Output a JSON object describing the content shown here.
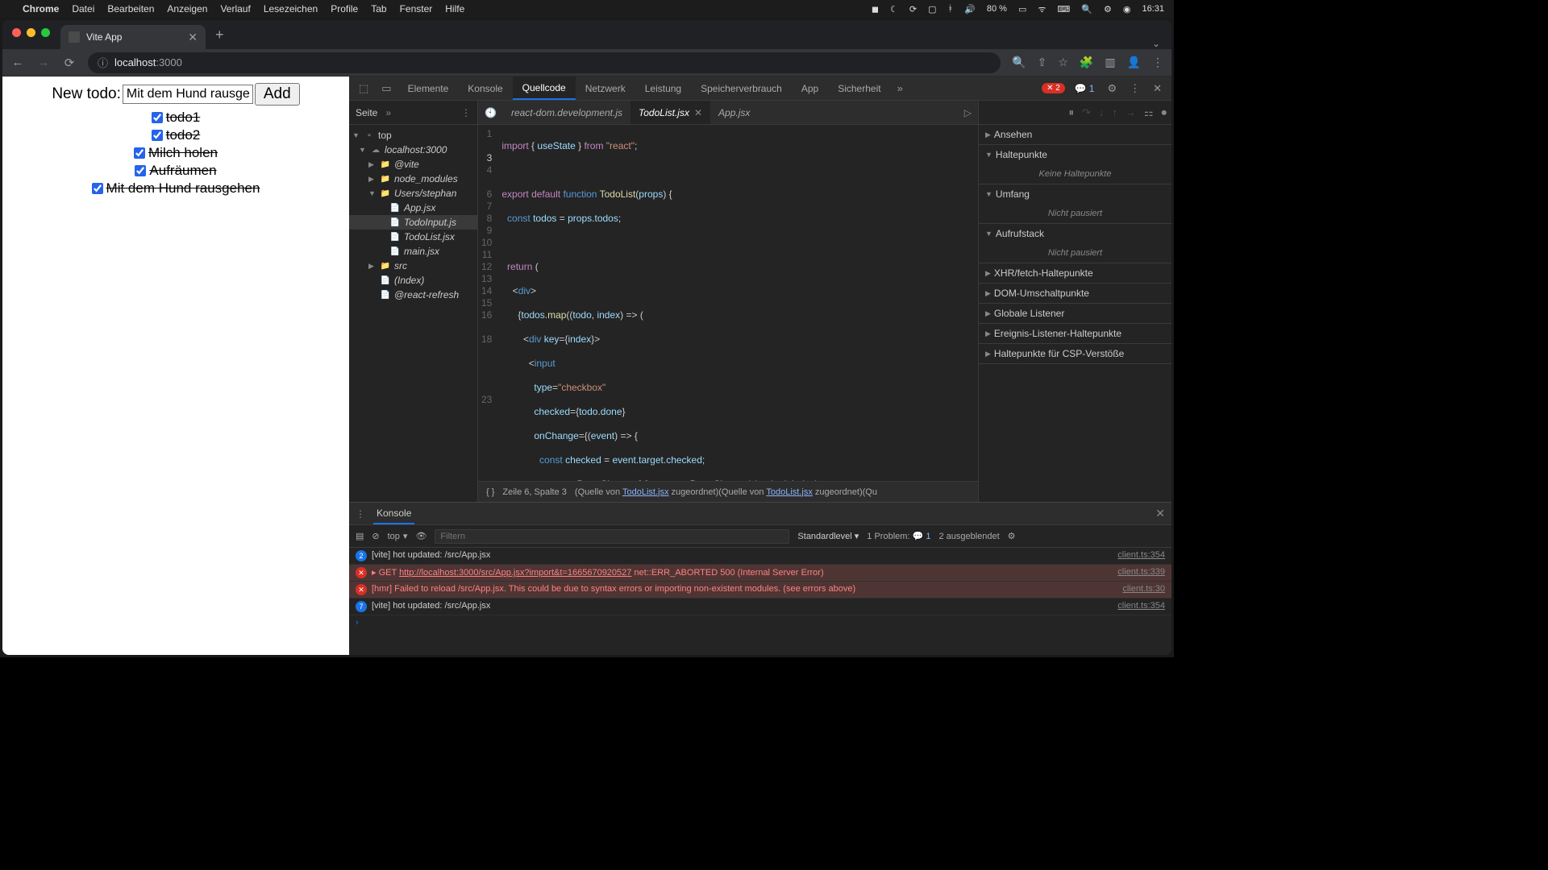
{
  "menubar": {
    "app": "Chrome",
    "items": [
      "Datei",
      "Bearbeiten",
      "Anzeigen",
      "Verlauf",
      "Lesezeichen",
      "Profile",
      "Tab",
      "Fenster",
      "Hilfe"
    ],
    "battery": "80 %",
    "time": "16:31"
  },
  "browser": {
    "tab_title": "Vite App",
    "url_host": "localhost",
    "url_path": ":3000"
  },
  "app": {
    "label": "New todo:",
    "input_value": "Mit dem Hund rausgehe",
    "add_button": "Add",
    "todos": [
      {
        "text": "todo1",
        "done": true
      },
      {
        "text": "todo2",
        "done": true
      },
      {
        "text": "Milch holen",
        "done": true
      },
      {
        "text": "Aufräumen",
        "done": true
      },
      {
        "text": "Mit dem Hund rausgehen",
        "done": true
      }
    ]
  },
  "devtools": {
    "tabs": [
      "Elemente",
      "Konsole",
      "Quellcode",
      "Netzwerk",
      "Leistung",
      "Speicherverbrauch",
      "App",
      "Sicherheit"
    ],
    "active_tab": "Quellcode",
    "error_count": "2",
    "info_count": "1",
    "page_label": "Seite",
    "tree": {
      "top": "top",
      "host": "localhost:3000",
      "vite": "@vite",
      "node_modules": "node_modules",
      "users": "Users/stephan",
      "files": [
        "App.jsx",
        "TodoInput.js",
        "TodoList.jsx",
        "main.jsx"
      ],
      "src": "src",
      "index": "(Index)",
      "refresh": "@react-refresh"
    },
    "source_tabs": {
      "t1": "react-dom.development.js",
      "t2": "TodoList.jsx",
      "t3": "App.jsx"
    },
    "status": {
      "pos": "Zeile 6, Spalte 3",
      "map1": "(Quelle von ",
      "file1": "TodoList.jsx",
      "map2": " zugeordnet)(Quelle von ",
      "file2": "TodoList.jsx",
      "map3": " zugeordnet)(Qu"
    },
    "debugger": {
      "sections": [
        "Ansehen",
        "Haltepunkte",
        "Umfang",
        "Aufrufstack",
        "XHR/fetch-Haltepunkte",
        "DOM-Umschaltpunkte",
        "Globale Listener",
        "Ereignis-Listener-Haltepunkte",
        "Haltepunkte für CSP-Verstöße"
      ],
      "no_breakpoints": "Keine Haltepunkte",
      "not_paused": "Nicht pausiert"
    },
    "console": {
      "title": "Konsole",
      "context": "top",
      "filter_placeholder": "Filtern",
      "level": "Standardlevel",
      "problems_label": "1 Problem:",
      "problems_count": "1",
      "hidden": "2 ausgeblendet",
      "logs": [
        {
          "type": "info",
          "badge": "2",
          "msg": "[vite] hot updated: /src/App.jsx",
          "src": "client.ts:354"
        },
        {
          "type": "err",
          "msg_pre": "GET ",
          "url": "http://localhost:3000/src/App.jsx?import&t=1665670920527",
          "msg_post": " net::ERR_ABORTED 500 (Internal Server Error)",
          "src": "client.ts:339"
        },
        {
          "type": "err",
          "msg": "[hmr] Failed to reload /src/App.jsx. This could be due to syntax errors or importing non-existent modules. (see errors above)",
          "src": "client.ts:30"
        },
        {
          "type": "info",
          "badge": "7",
          "msg": "[vite] hot updated: /src/App.jsx",
          "src": "client.ts:354"
        }
      ]
    }
  }
}
